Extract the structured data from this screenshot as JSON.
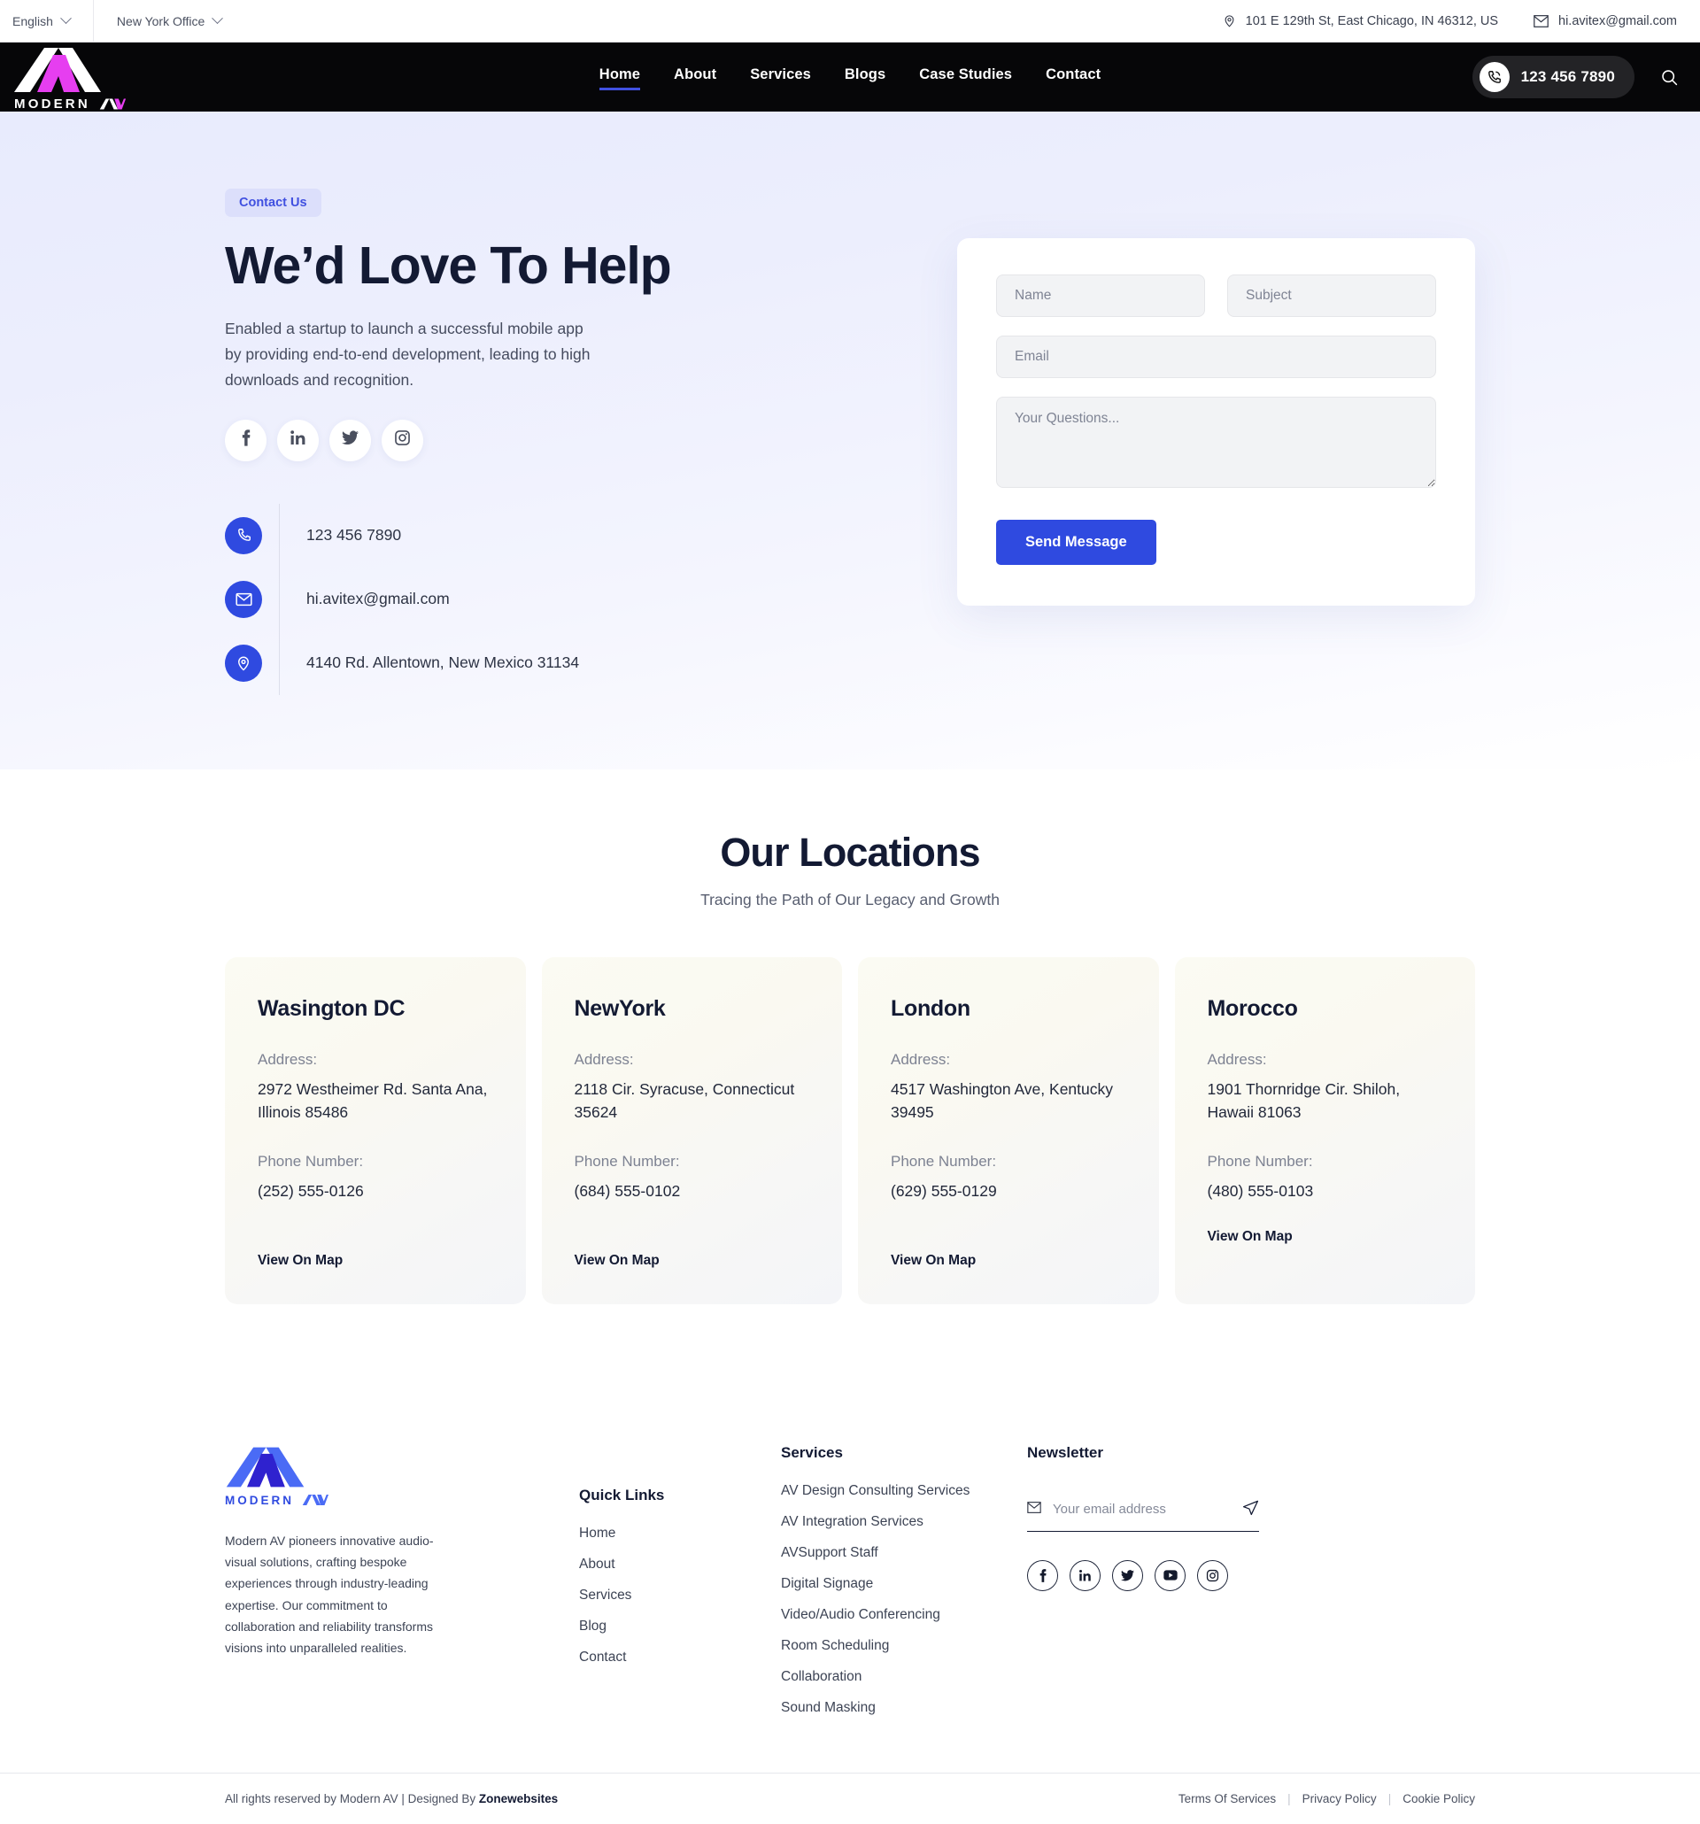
{
  "topbar": {
    "language": "English",
    "office": "New York Office",
    "address": "101 E 129th St, East Chicago, IN 46312, US",
    "email": "hi.avitex@gmail.com",
    "location_icon": "map-pin-icon",
    "mail_icon": "envelope-icon",
    "chevron_icon": "chevron-down-icon"
  },
  "nav": {
    "logo_text": "MODERN",
    "logo_av": "AV",
    "links": [
      {
        "label": "Home",
        "active": true
      },
      {
        "label": "About",
        "active": false
      },
      {
        "label": "Services",
        "active": false
      },
      {
        "label": "Blogs",
        "active": false
      },
      {
        "label": "Case Studies",
        "active": false
      },
      {
        "label": "Contact",
        "active": false
      }
    ],
    "phone": "123 456 7890",
    "phone_icon": "phone-ring-icon",
    "search_icon": "search-icon"
  },
  "hero": {
    "badge": "Contact Us",
    "title": "We’d Love To Help",
    "description": "Enabled a startup to launch a successful mobile app by providing end-to-end development, leading to high downloads and recognition.",
    "socials": [
      {
        "name": "facebook-icon"
      },
      {
        "name": "linkedin-icon"
      },
      {
        "name": "twitter-icon"
      },
      {
        "name": "instagram-icon"
      }
    ],
    "contacts": [
      {
        "icon": "phone-icon",
        "value": "123 456 7890"
      },
      {
        "icon": "envelope-icon",
        "value": "hi.avitex@gmail.com"
      },
      {
        "icon": "map-pin-icon",
        "value": "4140 Rd. Allentown, New Mexico 31134"
      }
    ]
  },
  "form": {
    "name_placeholder": "Name",
    "subject_placeholder": "Subject",
    "email_placeholder": "Email",
    "message_placeholder": "Your Questions...",
    "name_value": "",
    "subject_value": "",
    "email_value": "",
    "message_value": "",
    "submit_label": "Send Message",
    "accent_color": "#2f4ae0"
  },
  "locations": {
    "title": "Our Locations",
    "subtitle": "Tracing the Path of Our Legacy and Growth",
    "address_label": "Address:",
    "phone_label": "Phone Number:",
    "map_link_label": "View On Map",
    "cards": [
      {
        "city": "Wasington DC",
        "address_label": "Address:",
        "address": "2972 Westheimer Rd. Santa Ana, Illinois 85486",
        "phone_label": "Phone Number:",
        "phone": "(252) 555-0126",
        "map_link": "View On Map"
      },
      {
        "city": "NewYork",
        "address_label": "Address:",
        "address": "2118 Cir. Syracuse, Connecticut 35624",
        "phone_label": "Phone Number:",
        "phone": "(684) 555-0102",
        "map_link": "View On Map"
      },
      {
        "city": "London",
        "address_label": "Address:",
        "address": "4517 Washington Ave, Kentucky 39495",
        "phone_label": "Phone Number:",
        "phone": "(629) 555-0129",
        "map_link": "View On Map"
      },
      {
        "city": "Morocco",
        "address_label": "Address:",
        "address": "1901 Thornridge Cir. Shiloh, Hawaii 81063",
        "phone_label": "Phone Number:",
        "phone": "(480) 555-0103",
        "map_link": "View On Map"
      }
    ]
  },
  "footer": {
    "logo_text": "MODERN",
    "logo_av": "AV",
    "about": "Modern AV pioneers innovative audio-visual solutions, crafting bespoke experiences through industry-leading expertise. Our commitment to collaboration and reliability transforms visions into unparalleled realities.",
    "quick_links_head": "Quick Links",
    "quick_links": [
      {
        "label": "Home"
      },
      {
        "label": "About"
      },
      {
        "label": "Services"
      },
      {
        "label": "Blog"
      },
      {
        "label": "Contact"
      }
    ],
    "services_head": "Services",
    "services": [
      {
        "label": "AV Design Consulting Services"
      },
      {
        "label": "AV Integration Services"
      },
      {
        "label": "AVSupport Staff"
      },
      {
        "label": "Digital Signage"
      },
      {
        "label": "Video/Audio Conferencing"
      },
      {
        "label": "Room Scheduling"
      },
      {
        "label": "Collaboration"
      },
      {
        "label": "Sound Masking"
      }
    ],
    "newsletter_head": "Newsletter",
    "newsletter_placeholder": "Your email address",
    "newsletter_value": "",
    "newsletter_mail_icon": "envelope-icon",
    "newsletter_send_icon": "send-plane-icon",
    "socials": [
      {
        "name": "facebook-icon"
      },
      {
        "name": "linkedin-icon"
      },
      {
        "name": "twitter-icon"
      },
      {
        "name": "youtube-icon"
      },
      {
        "name": "instagram-icon"
      }
    ],
    "copyright": "All rights reserved by Modern AV | Designed By ",
    "designer": "Zonewebsites",
    "legal": [
      {
        "label": "Terms Of Services"
      },
      {
        "label": "Privacy Policy"
      },
      {
        "label": "Cookie Policy"
      }
    ]
  }
}
